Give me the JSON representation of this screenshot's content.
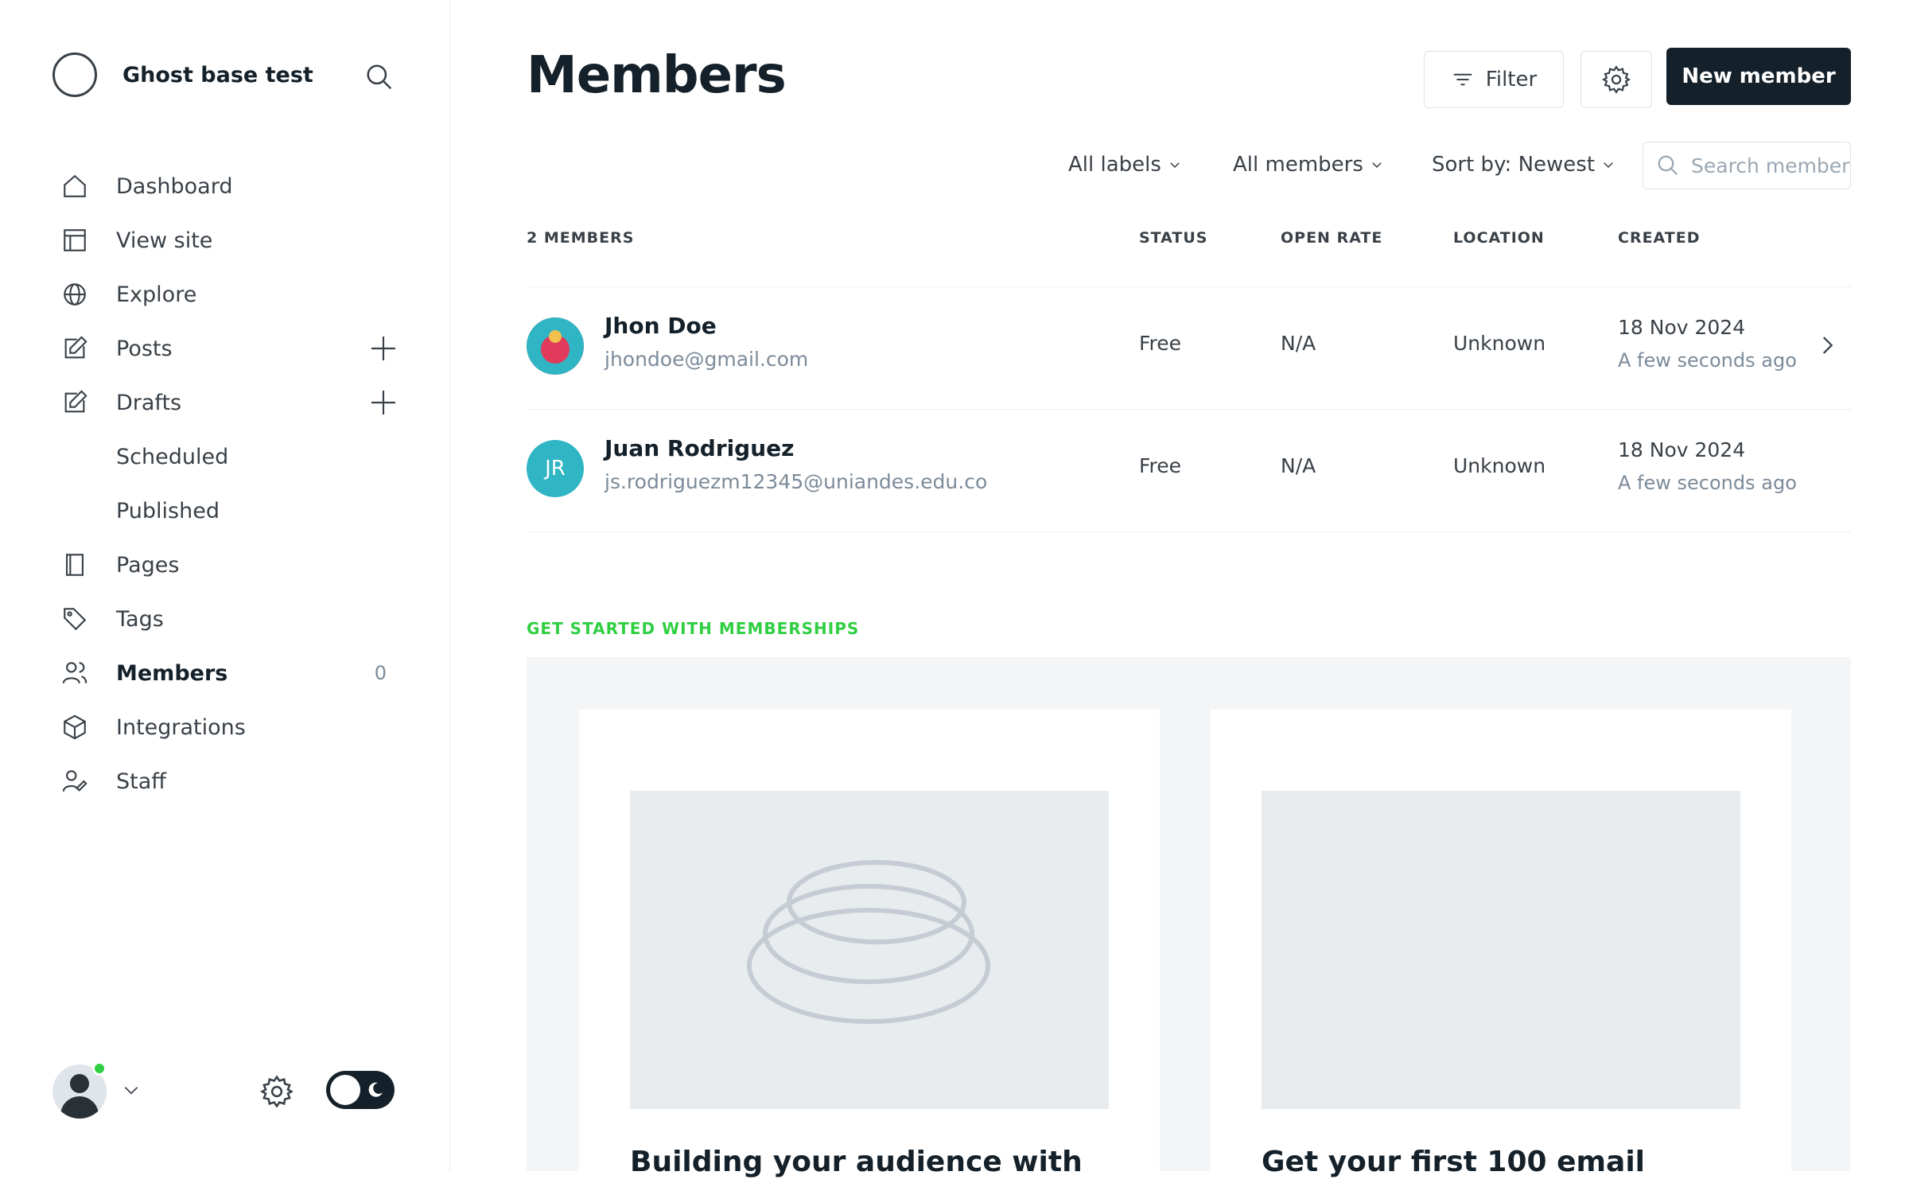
{
  "brand": {
    "title": "Ghost base test"
  },
  "nav": {
    "dashboard": "Dashboard",
    "view_site": "View site",
    "explore": "Explore",
    "posts": "Posts",
    "drafts": "Drafts",
    "scheduled": "Scheduled",
    "published": "Published",
    "pages": "Pages",
    "tags": "Tags",
    "members": "Members",
    "members_count": "0",
    "integrations": "Integrations",
    "staff": "Staff"
  },
  "header": {
    "title": "Members",
    "filter_label": "Filter",
    "new_member_label": "New member"
  },
  "filters": {
    "labels": "All labels",
    "members": "All members",
    "sort": "Sort by: Newest",
    "search_placeholder": "Search members..."
  },
  "table": {
    "columns": {
      "member": "2 MEMBERS",
      "status": "STATUS",
      "open_rate": "OPEN RATE",
      "location": "LOCATION",
      "created": "CREATED"
    },
    "rows": [
      {
        "name": "Jhon Doe",
        "email": "jhondoe@gmail.com",
        "status": "Free",
        "open_rate": "N/A",
        "location": "Unknown",
        "created": "18 Nov 2024",
        "created_ago": "A few seconds ago",
        "avatar_color": "#e23a5a"
      },
      {
        "name": "Juan Rodriguez",
        "initials": "JR",
        "email": "js.rodriguezm12345@uniandes.edu.co",
        "status": "Free",
        "open_rate": "N/A",
        "location": "Unknown",
        "created": "18 Nov 2024",
        "created_ago": "A few seconds ago",
        "avatar_color": "#2fb5c4"
      }
    ]
  },
  "get_started": {
    "title": "GET STARTED WITH MEMBERSHIPS",
    "cards": [
      {
        "title": "Building your audience with"
      },
      {
        "title": "Get your first 100 email"
      }
    ]
  },
  "colors": {
    "accent": "#30cf43",
    "primary_text": "#15212a",
    "button_dark": "#15212a"
  }
}
